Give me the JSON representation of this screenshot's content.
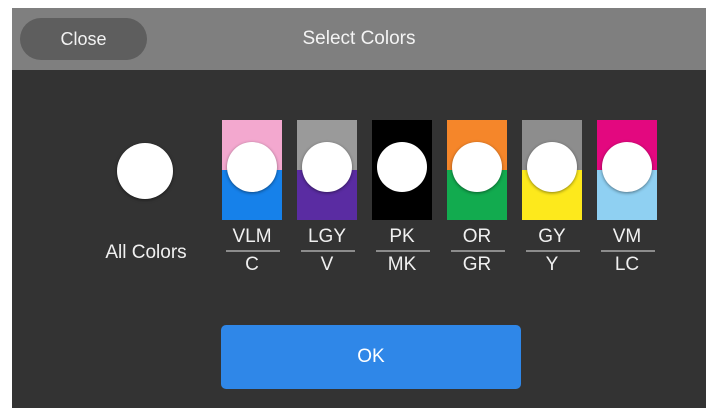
{
  "header": {
    "close_label": "Close",
    "title": "Select Colors"
  },
  "all_colors": {
    "label": "All Colors"
  },
  "channels": [
    {
      "top": "VLM",
      "bottom": "C",
      "top_color": "#f3a8cf",
      "bottom_color": "#1681ea"
    },
    {
      "top": "LGY",
      "bottom": "V",
      "top_color": "#9a9a9a",
      "bottom_color": "#5a2ca2"
    },
    {
      "top": "PK",
      "bottom": "MK",
      "top_color": "#000000",
      "bottom_color": "#000000"
    },
    {
      "top": "OR",
      "bottom": "GR",
      "top_color": "#f5862a",
      "bottom_color": "#12ab4f"
    },
    {
      "top": "GY",
      "bottom": "Y",
      "top_color": "#8d8d8d",
      "bottom_color": "#fde91c"
    },
    {
      "top": "VM",
      "bottom": "LC",
      "top_color": "#e3087f",
      "bottom_color": "#8fd0f2"
    }
  ],
  "footer": {
    "ok_label": "OK"
  },
  "colors": {
    "dialog_bg": "#333333",
    "titlebar_bg": "#7f7f7f",
    "ok_blue": "#2f87e8"
  }
}
